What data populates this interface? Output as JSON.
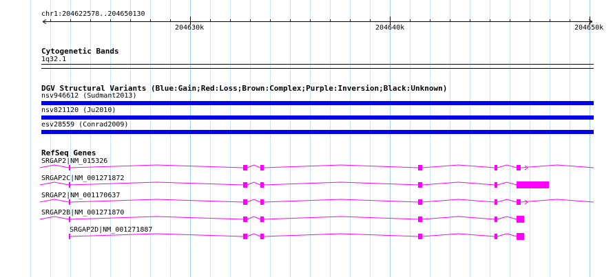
{
  "ruler": {
    "location": "chr1:204622578..204650130",
    "ticks": [
      {
        "label": "204630k",
        "pos": 204630000
      },
      {
        "label": "204640k",
        "pos": 204640000
      },
      {
        "label": "204650k",
        "pos": 204650000
      }
    ]
  },
  "cytoband_track": {
    "title": "Cytogenetic Bands",
    "band": "1q32.1"
  },
  "dgv_track": {
    "title": "DGV Structural Variants (Blue:Gain;Red:Loss;Brown:Complex;Purple:Inversion;Black:Unknown)",
    "color": "#0000ee",
    "variants": [
      {
        "label": "nsv946612 (Sudmant2013)"
      },
      {
        "label": "nsv821120 (Ju2010)"
      },
      {
        "label": "esv28559 (Conrad2009)"
      }
    ]
  },
  "refseq_track": {
    "title": "RefSeq Genes",
    "color": "#ff00ff",
    "genes": [
      {
        "label": "SRGAP2|NM_015326"
      },
      {
        "label": "SRGAP2C|NM_001271872"
      },
      {
        "label": "SRGAP2|NM_001170637"
      },
      {
        "label": "SRGAP2B|NM_001271870"
      },
      {
        "label": "SRGAP2D|NM_001271887"
      }
    ]
  }
}
